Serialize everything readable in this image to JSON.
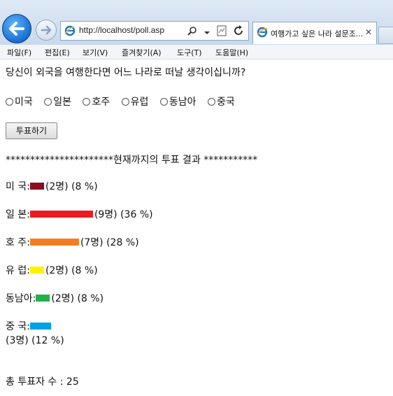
{
  "browser": {
    "url": "http://localhost/poll.asp",
    "tab_title": "여행가고 싶은 나라 설문조...",
    "tab_close": "✕",
    "menu": [
      "파일(F)",
      "편집(E)",
      "보기(V)",
      "즐겨찾기(A)",
      "도구(T)",
      "도움말(H)"
    ]
  },
  "page": {
    "question": "당신이 외국을 여행한다면 어느 나라로 떠날 생각이십니까?",
    "options": [
      "미국",
      "일본",
      "호주",
      "유럽",
      "동남아",
      "중국"
    ],
    "vote_button": "투표하기",
    "results_header": "**********************현재까지의 투표 결과 ***********",
    "results": [
      {
        "label": "미  국",
        "sep": " : ",
        "votes": 2,
        "percent": 8,
        "color": "#8b0d1f",
        "stats": "(2명) (8 %)"
      },
      {
        "label": "일  본",
        "sep": " : ",
        "votes": 9,
        "percent": 36,
        "color": "#ed1c24",
        "stats": "(9명) (36 %)"
      },
      {
        "label": "호  주",
        "sep": " : ",
        "votes": 7,
        "percent": 28,
        "color": "#f47c20",
        "stats": "(7명) (28 %)"
      },
      {
        "label": "유  럽",
        "sep": " : ",
        "votes": 2,
        "percent": 8,
        "color": "#fff200",
        "stats": "(2명) (8 %)"
      },
      {
        "label": "동남아",
        "sep": " : ",
        "votes": 2,
        "percent": 8,
        "color": "#22b14c",
        "stats": "(2명) (8 %)"
      },
      {
        "label": "중  국",
        "sep": " : ",
        "votes": 3,
        "percent": 12,
        "color": "#00a2e8",
        "stats": "(3명) (12 %)"
      }
    ],
    "total_label": "총 투표자 수 : 25"
  }
}
